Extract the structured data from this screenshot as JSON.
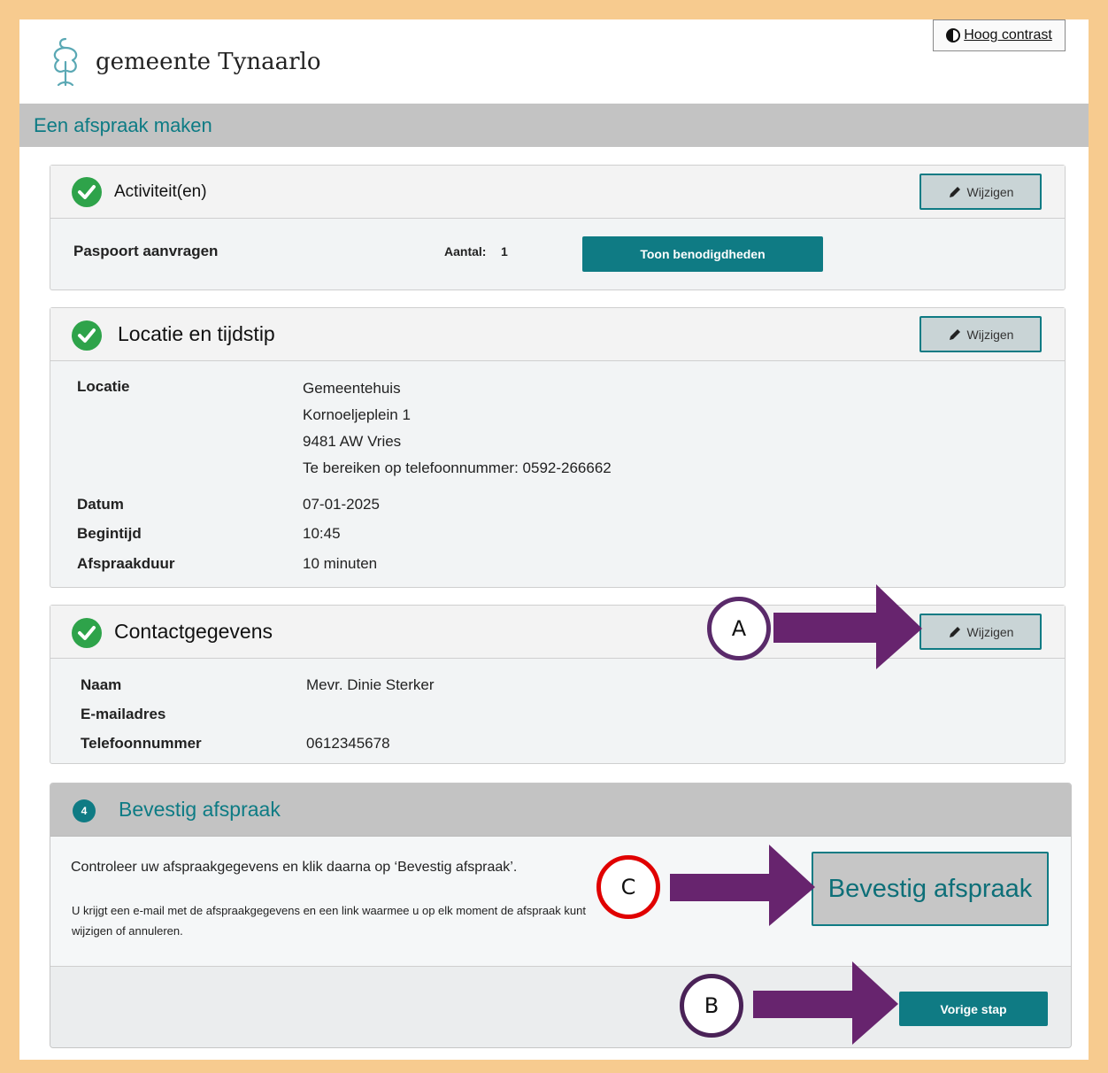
{
  "header": {
    "logo_text": "gemeente Tynaarlo",
    "contrast_label": "Hoog contrast",
    "page_title": "Een afspraak maken"
  },
  "activities": {
    "title": "Activiteit(en)",
    "edit_label": "Wijzigen",
    "item_name": "Paspoort aanvragen",
    "count_label": "Aantal:",
    "count_value": "1",
    "requirements_button": "Toon benodigdheden"
  },
  "location": {
    "title": "Locatie en tijdstip",
    "edit_label": "Wijzigen",
    "location_label": "Locatie",
    "address": [
      "Gemeentehuis",
      "Kornoeljeplein 1",
      "9481 AW Vries",
      "Te bereiken op telefoonnummer: 0592-266662"
    ],
    "date_label": "Datum",
    "date_value": "07-01-2025",
    "start_label": "Begintijd",
    "start_value": "10:45",
    "duration_label": "Afspraakduur",
    "duration_value": "10 minuten"
  },
  "contact": {
    "title": "Contactgegevens",
    "edit_label": "Wijzigen",
    "name_label": "Naam",
    "name_value": "Mevr. Dinie Sterker",
    "email_label": "E-mailadres",
    "email_value": "",
    "phone_label": "Telefoonnummer",
    "phone_value": "0612345678"
  },
  "confirm": {
    "step_number": "4",
    "title": "Bevestig afspraak",
    "instruction": "Controleer uw afspraakgegevens en klik daarna op ‘Bevestig afspraak’.",
    "note": "U krijgt een e-mail met de afspraakgegevens en een link waarmee u op elk moment de afspraak kunt wijzigen of annuleren.",
    "confirm_button": "Bevestig afspraak",
    "previous_button": "Vorige stap"
  },
  "annotations": {
    "a": "A",
    "b": "B",
    "c": "C"
  },
  "colors": {
    "page_border": "#f7cb8f",
    "teal": "#0f7b84",
    "check_green": "#2ea34a",
    "arrow_purple": "#67246e",
    "annotation_purple": "#5a2a6a",
    "annotation_red": "#e00000",
    "header_gray": "#c3c3c3"
  }
}
